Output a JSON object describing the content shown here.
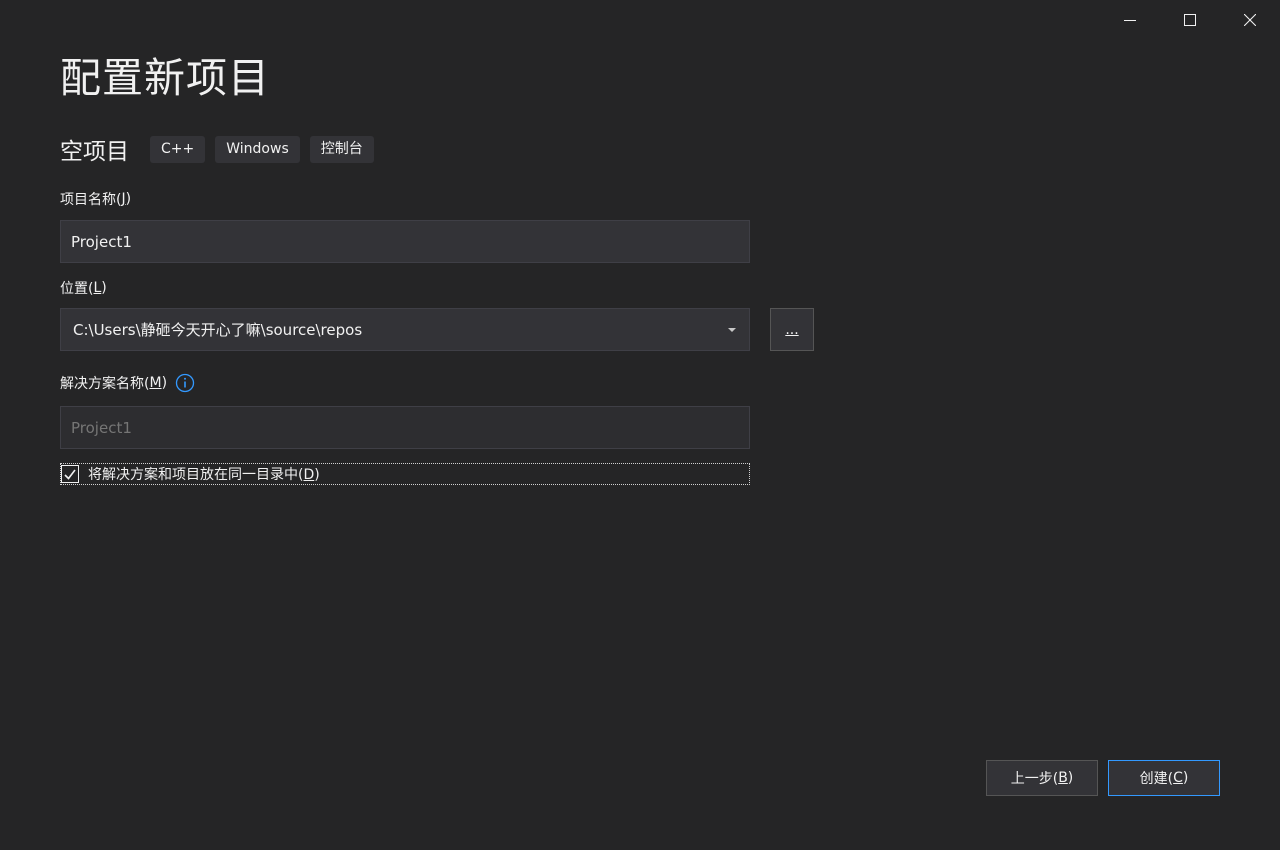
{
  "window": {
    "controls": {
      "minimize_icon": "minimize-icon",
      "maximize_icon": "maximize-icon",
      "close_icon": "close-icon"
    }
  },
  "page_title": "配置新项目",
  "template": {
    "name": "空项目",
    "tags": [
      "C++",
      "Windows",
      "控制台"
    ]
  },
  "project_name": {
    "label_prefix": "项目名称(",
    "label_key": "J",
    "label_suffix": ")",
    "value": "Project1"
  },
  "location": {
    "label_prefix": "位置(",
    "label_key": "L",
    "label_suffix": ")",
    "value": "C:\\Users\\静砸今天开心了嘛\\source\\repos",
    "browse_label": "..."
  },
  "solution_name": {
    "label_prefix": "解决方案名称(",
    "label_key": "M",
    "label_suffix": ")",
    "placeholder": "Project1",
    "info_icon": "info-icon"
  },
  "same_dir_checkbox": {
    "checked": true,
    "label_prefix": "将解决方案和项目放在同一目录中(",
    "label_key": "D",
    "label_suffix": ")"
  },
  "footer": {
    "back_prefix": "上一步(",
    "back_key": "B",
    "back_suffix": ")",
    "create_prefix": "创建(",
    "create_key": "C",
    "create_suffix": ")"
  },
  "colors": {
    "background": "#252526",
    "input_bg": "#333337",
    "accent": "#3399ff",
    "text": "#f1f1f1"
  }
}
